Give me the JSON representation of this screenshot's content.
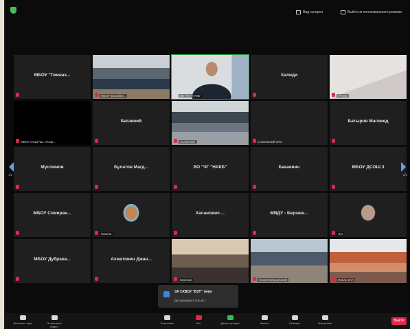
{
  "topbar": {
    "view_label": "Вид галереи",
    "fullscreen_label": "Выйти из полноэкранного режима"
  },
  "tiles": [
    {
      "name": "МБОУ \"Гимназ...",
      "kind": "name"
    },
    {
      "name": "",
      "kind": "video",
      "caption": "МБОУ-Балабан..."
    },
    {
      "name": "",
      "kind": "video",
      "caption": "ВО \"ЧГ \"НАКБ\""
    },
    {
      "name": "Халиди",
      "kind": "name"
    },
    {
      "name": "",
      "kind": "video",
      "caption": "iPhone"
    },
    {
      "name": "",
      "kind": "black",
      "caption": "МБОУ СОШ №1 г.Назр..."
    },
    {
      "name": "Багаевий",
      "kind": "name"
    },
    {
      "name": "",
      "kind": "video",
      "caption": "Аслан ВЗУ"
    },
    {
      "name": "",
      "kind": "name",
      "caption": "Сомоевский ЗАО"
    },
    {
      "name": "Батыров Магомед",
      "kind": "name"
    },
    {
      "name": "Муслимов",
      "kind": "name"
    },
    {
      "name": "Булатов Магд...",
      "kind": "name"
    },
    {
      "name": "ВО \"ЧГ \"НАКБ\"",
      "kind": "name"
    },
    {
      "name": "Бакаевич",
      "kind": "name"
    },
    {
      "name": "МБОУ ДСОШ 3",
      "kind": "name"
    },
    {
      "name": "МБОУ Сомиран...",
      "kind": "name"
    },
    {
      "name": "",
      "kind": "video",
      "caption": "Никола"
    },
    {
      "name": "Хасанович ...",
      "kind": "name"
    },
    {
      "name": "МВДУ - Бершен...",
      "kind": "name"
    },
    {
      "name": "",
      "kind": "video",
      "caption": "Луз"
    },
    {
      "name": "МБОУ Дубрава...",
      "kind": "name"
    },
    {
      "name": "Ахматович Джан...",
      "kind": "name"
    },
    {
      "name": "",
      "kind": "video",
      "caption": "Борсаки"
    },
    {
      "name": "",
      "kind": "video",
      "caption": "Газиев Бершевский"
    },
    {
      "name": "",
      "kind": "video",
      "caption": "Ильяс ЗАЛ"
    }
  ],
  "pages": {
    "left": "1/2",
    "right": "2/2"
  },
  "notification": {
    "title": "ЗА СКВОУ \"ВЗТ\" тюве",
    "subtitle": "Дессредние 5 чол.ист"
  },
  "toolbar": {
    "items": [
      "Включить звук",
      "Остановить видео",
      "Участники",
      "Чат",
      "Демонстрация",
      "Запись",
      "Реакции",
      "Настройки"
    ],
    "end_label": "Выйти"
  },
  "colors": {
    "background": "#0b0b0b",
    "tile": "#1f1f1f",
    "muted": "#e0284a",
    "accent": "#5ba3e8",
    "active": "#2f9e40"
  }
}
